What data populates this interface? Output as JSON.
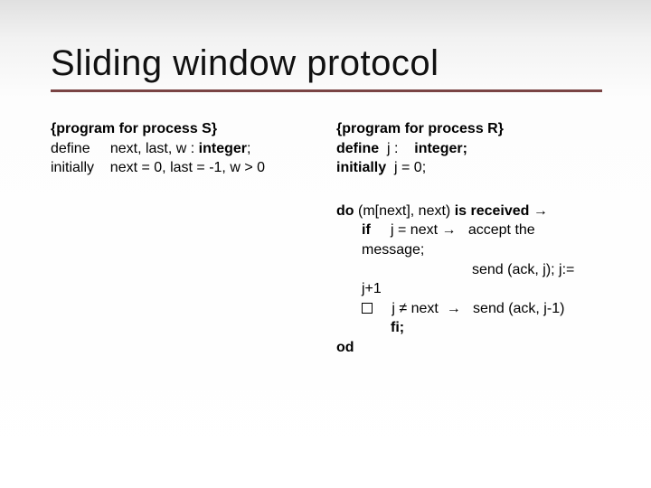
{
  "title": "Sliding window protocol",
  "left": {
    "header": "{program for process S}",
    "define_kw": "define",
    "define_rest": "next,  last, w : integer;",
    "init_kw": "initially",
    "init_rest": "next = 0, last = -1, w > 0"
  },
  "right": {
    "header": "{program for process R}",
    "define_kw": "define",
    "define_vars": "j   :",
    "define_type": "integer;",
    "init_kw": "initially",
    "init_rest": "j = 0;",
    "do_kw": "do",
    "do_cond_pre": "(m[next], next) is received",
    "arrow": "→",
    "if_kw": "if",
    "if_cond": "j = next",
    "accept_pre": "accept  the",
    "accept_post": "message;",
    "send_ack": "send (ack, j); j:=",
    "jplus": "j+1",
    "alt_cond": "j ≠ next",
    "alt_action": "send (ack, j-1)",
    "fi": "fi;",
    "od": "od"
  }
}
